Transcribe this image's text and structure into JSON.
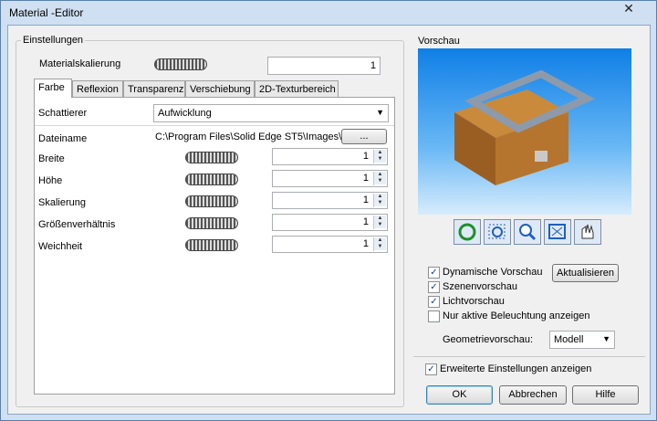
{
  "window": {
    "title": "Material -Editor",
    "close": "✕"
  },
  "settings": {
    "group_label": "Einstellungen",
    "materialskalierung_label": "Materialskalierung",
    "materialskalierung_value": "1"
  },
  "tabs": [
    "Farbe",
    "Reflexion",
    "Transparenz",
    "Verschiebung",
    "2D-Texturbereich"
  ],
  "farbe": {
    "schattierer_label": "Schattierer",
    "schattierer_value": "Aufwicklung",
    "dateiname_label": "Dateiname",
    "dateiname_value": "C:\\Program Files\\Solid Edge ST5\\Images\\",
    "browse_label": "...",
    "rows": [
      {
        "label": "Breite",
        "value": "1"
      },
      {
        "label": "Höhe",
        "value": "1"
      },
      {
        "label": "Skalierung",
        "value": "1"
      },
      {
        "label": "Größenverhältnis",
        "value": "1"
      },
      {
        "label": "Weichheit",
        "value": "1"
      }
    ]
  },
  "preview": {
    "group_label": "Vorschau",
    "tools": [
      "rotate-icon",
      "zoom-area-icon",
      "zoom-icon",
      "fit-icon",
      "pan-icon"
    ],
    "dynamische": "Dynamische Vorschau",
    "szenen": "Szenenvorschau",
    "licht": "Lichtvorschau",
    "nur_aktive": "Nur aktive Beleuchtung anzeigen",
    "aktualisieren": "Aktualisieren",
    "geo_label": "Geometrievorschau:",
    "geo_value": "Modell"
  },
  "footer": {
    "erweitert": "Erweiterte Einstellungen anzeigen",
    "ok": "OK",
    "abbrechen": "Abbrechen",
    "hilfe": "Hilfe"
  }
}
